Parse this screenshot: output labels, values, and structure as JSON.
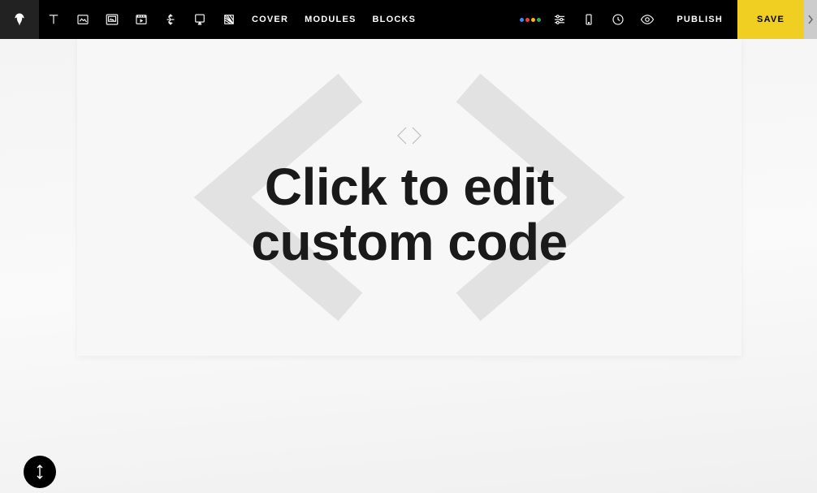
{
  "topbar": {
    "nav": {
      "cover": "COVER",
      "modules": "MODULES",
      "blocks": "BLOCKS"
    },
    "publish": "PUBLISH",
    "save": "SAVE"
  },
  "block": {
    "line1": "Click to edit",
    "line2": "custom code"
  },
  "icons": {
    "logo": "eagle-logo",
    "text": "text-tool",
    "image": "image-tool",
    "gallery": "framed-image-tool",
    "video": "video-frame-tool",
    "divider": "divider-tool",
    "embed": "embed-tool",
    "texture": "texture-tool",
    "ai": "ai-assistant",
    "settings": "sliders-settings",
    "mobile": "mobile-preview",
    "history": "history-clock",
    "preview": "eye-preview",
    "expand": "chevron-right",
    "reorder": "updown-arrows",
    "code": "code-brackets"
  },
  "colors": {
    "accent": "#f0ce22",
    "bg": "#f5f5f5",
    "ai_blue": "#4285f4",
    "ai_red": "#ea4335",
    "ai_yellow": "#fbbc05",
    "ai_green": "#34a853"
  }
}
